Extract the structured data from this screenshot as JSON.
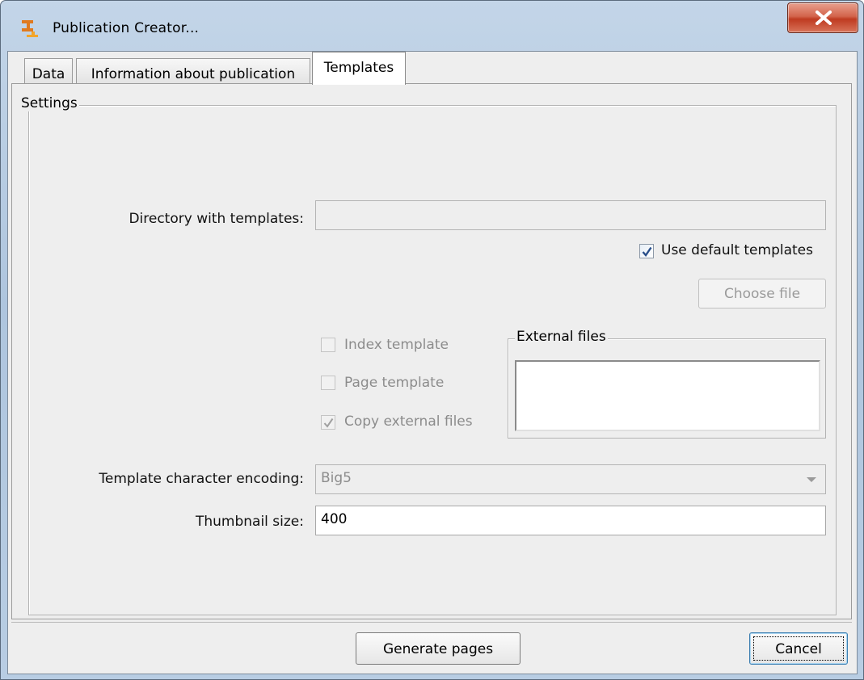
{
  "window": {
    "title": "Publication Creator...",
    "icon": "app-logo-icon",
    "close_icon": "close-icon"
  },
  "tabs": [
    {
      "label": "Data",
      "active": false
    },
    {
      "label": "Information about publication",
      "active": false
    },
    {
      "label": "Templates",
      "active": true
    }
  ],
  "settings": {
    "group_title": "Settings",
    "directory_label": "Directory with templates:",
    "directory_value": "",
    "use_default_label": "Use default templates",
    "use_default_checked": true,
    "choose_file_label": "Choose file",
    "index_template_label": "Index template",
    "index_template_checked": false,
    "page_template_label": "Page template",
    "page_template_checked": false,
    "copy_external_label": "Copy external files",
    "copy_external_checked": true,
    "external_files_title": "External files",
    "encoding_label": "Template character encoding:",
    "encoding_value": "Big5",
    "thumbnail_label": "Thumbnail size:",
    "thumbnail_value": "400"
  },
  "footer": {
    "generate_label": "Generate pages",
    "cancel_label": "Cancel"
  },
  "colors": {
    "frame": "#aec5de",
    "close_button": "#c94a30",
    "panel": "#eeeeee",
    "check_mark": "#2a4f8a",
    "disabled_text": "#8c8c8c"
  }
}
